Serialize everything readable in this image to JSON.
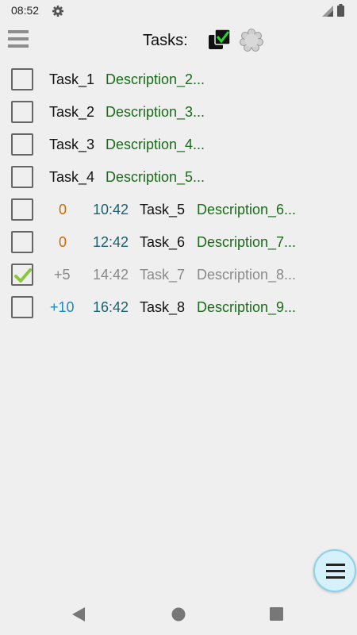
{
  "status_bar": {
    "time": "08:52",
    "icons": [
      "gear-icon",
      "signal-icon",
      "battery-icon"
    ]
  },
  "app_bar": {
    "title": "Tasks:",
    "icons": [
      "menu-icon",
      "tasks-checkbox-icon",
      "settings-flower-icon"
    ]
  },
  "tasks": [
    {
      "checked": false,
      "offset": "",
      "time": "",
      "name": "Task_1",
      "description": "Description_2..."
    },
    {
      "checked": false,
      "offset": "",
      "time": "",
      "name": "Task_2",
      "description": "Description_3..."
    },
    {
      "checked": false,
      "offset": "",
      "time": "",
      "name": "Task_3",
      "description": "Description_4..."
    },
    {
      "checked": false,
      "offset": "",
      "time": "",
      "name": "Task_4",
      "description": "Description_5..."
    },
    {
      "checked": false,
      "offset": "0",
      "time": "10:42",
      "name": "Task_5",
      "description": "Description_6..."
    },
    {
      "checked": false,
      "offset": "0",
      "time": "12:42",
      "name": "Task_6",
      "description": "Description_7..."
    },
    {
      "checked": true,
      "offset": "+5",
      "time": "14:42",
      "name": "Task_7",
      "description": "Description_8..."
    },
    {
      "checked": false,
      "offset": "+10",
      "time": "16:42",
      "name": "Task_8",
      "description": "Description_9..."
    }
  ],
  "colors": {
    "background": "#efefef",
    "description": "#1a6b1a",
    "offset_orange": "#d06a00",
    "offset_blue": "#1c89c2",
    "time": "#1c6170",
    "done_text": "#8a8a8a",
    "fab_fill": "#d4f1fc"
  },
  "fab": {
    "icon": "hamburger-icon"
  },
  "nav_bar": {
    "icons": [
      "back-icon",
      "home-icon",
      "recents-icon"
    ]
  }
}
